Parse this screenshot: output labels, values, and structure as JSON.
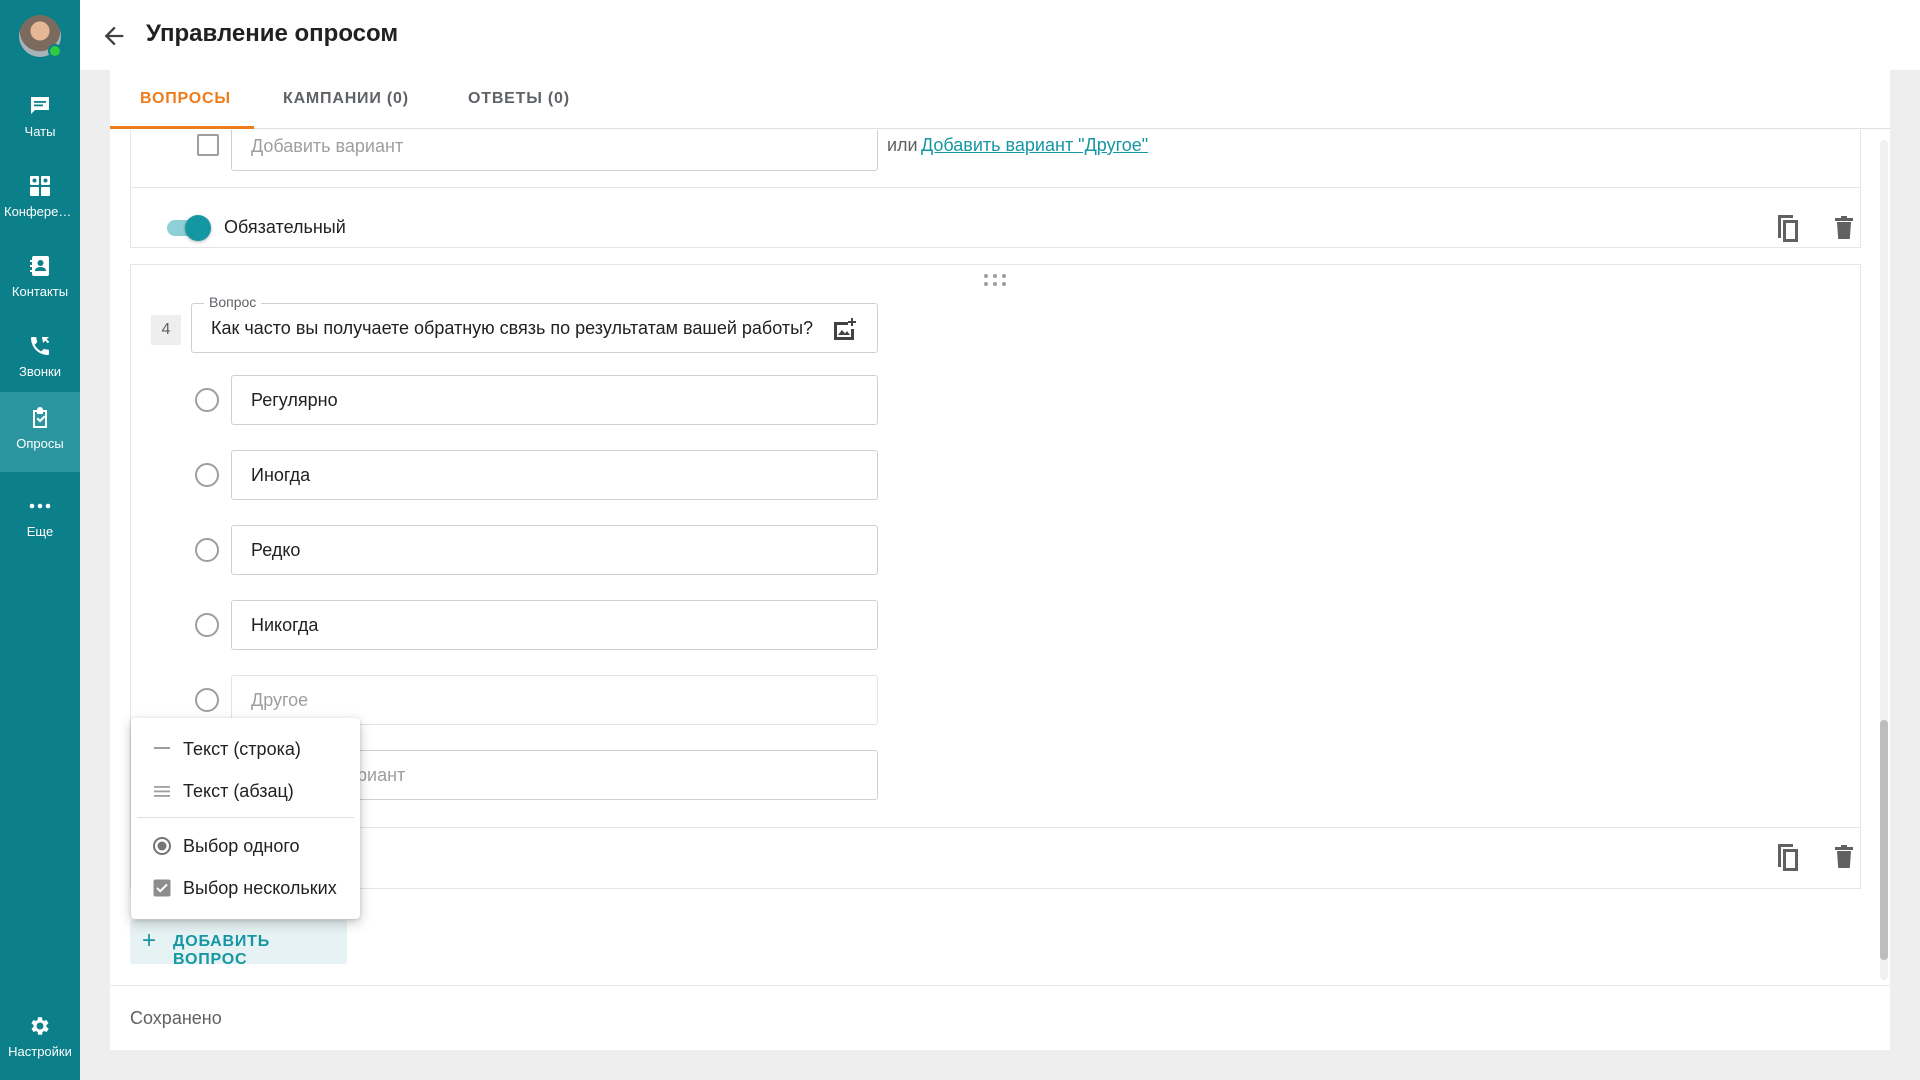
{
  "sidebar": {
    "items": [
      {
        "label": "Чаты",
        "icon": "chat-icon"
      },
      {
        "label": "Конференции",
        "icon": "conference-icon"
      },
      {
        "label": "Контакты",
        "icon": "contacts-icon"
      },
      {
        "label": "Звонки",
        "icon": "calls-icon"
      },
      {
        "label": "Опросы",
        "icon": "surveys-icon"
      },
      {
        "label": "Еще",
        "icon": "more-icon"
      }
    ],
    "settings_label": "Настройки"
  },
  "header": {
    "title": "Управление опросом"
  },
  "tabs": [
    {
      "label": "ВОПРОСЫ"
    },
    {
      "label": "КАМПАНИИ (0)"
    },
    {
      "label": "ОТВЕТЫ (0)"
    }
  ],
  "prev_question": {
    "add_option_placeholder": "Добавить вариант",
    "or_text": "или",
    "add_other_link": "Добавить вариант \"Другое\"",
    "required_label": "Обязательный",
    "required_on": true
  },
  "question": {
    "number": "4",
    "legend": "Вопрос",
    "text": "Как часто вы получаете обратную связь по результатам вашей работы?",
    "options": [
      "Регулярно",
      "Иногда",
      "Редко",
      "Никогда"
    ],
    "other_placeholder": "Другое",
    "add_option_partial": "риант"
  },
  "type_menu": {
    "items": [
      {
        "label": "Текст (строка)",
        "icon": "short-text-icon"
      },
      {
        "label": "Текст (абзац)",
        "icon": "paragraph-icon"
      },
      {
        "label": "Выбор одного",
        "icon": "radio-icon"
      },
      {
        "label": "Выбор нескольких",
        "icon": "checkbox-icon"
      }
    ]
  },
  "add_question_label": "ДОБАВИТЬ ВОПРОС",
  "status_text": "Сохранено",
  "colors": {
    "sidebar": "#0b7f8a",
    "accent_tab": "#ef7c1b",
    "teal": "#1597a3"
  }
}
